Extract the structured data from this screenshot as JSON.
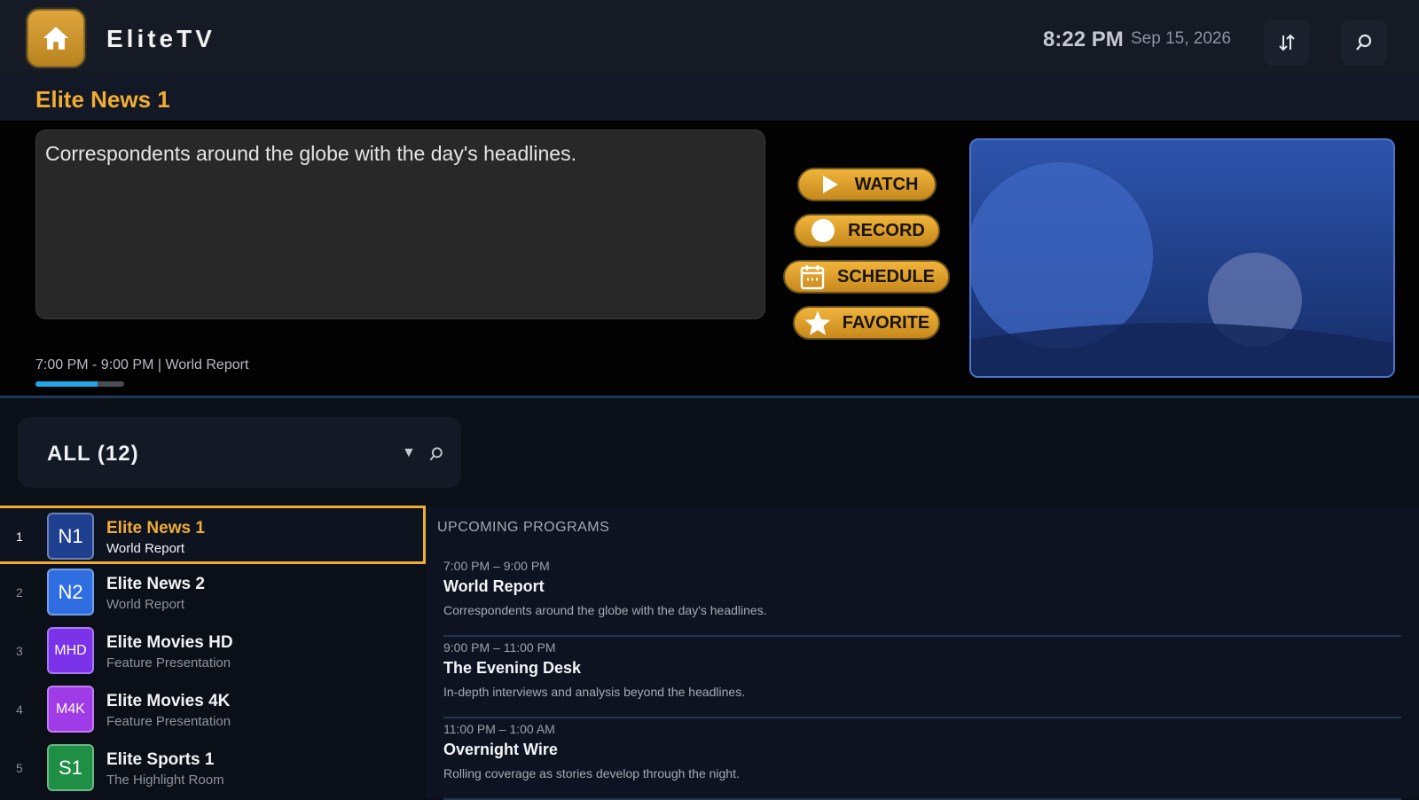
{
  "header": {
    "app_title": "EliteTV",
    "time": "8:22 PM",
    "date": "Sep 15, 2026",
    "icons": [
      "home-icon",
      "sort-icon",
      "search-icon"
    ],
    "accent_color": "#f0ad32"
  },
  "channel": {
    "title": "Elite News 1",
    "description": "Correspondents around the globe with the day's headlines.",
    "time_line": "7:00 PM - 9:00 PM | World Report",
    "progress": 0.7
  },
  "actions": [
    {
      "label": "WATCH",
      "icon": "play-icon"
    },
    {
      "label": "RECORD",
      "icon": "record-icon"
    },
    {
      "label": "SCHEDULE",
      "icon": "calendar-icon"
    },
    {
      "label": "FAVORITE",
      "icon": "star-icon"
    }
  ],
  "filter": {
    "label": "ALL (12)"
  },
  "channels": [
    {
      "number": "1",
      "logo": "N1",
      "logo_color": "#1f3f8f",
      "name": "Elite News 1",
      "program": "World Report"
    },
    {
      "number": "2",
      "logo": "N2",
      "logo_color": "#2f6ee0",
      "name": "Elite News 2",
      "program": "World Report"
    },
    {
      "number": "3",
      "logo": "MHD",
      "logo_color": "#7a33e8",
      "name": "Elite Movies HD",
      "program": "Feature Presentation"
    },
    {
      "number": "4",
      "logo": "M4K",
      "logo_color": "#a03be8",
      "name": "Elite Movies 4K",
      "program": "Feature Presentation"
    },
    {
      "number": "5",
      "logo": "S1",
      "logo_color": "#1f8f46",
      "name": "Elite Sports 1",
      "program": "The Highlight Room"
    }
  ],
  "upcoming": {
    "heading": "UPCOMING PROGRAMS",
    "programs": [
      {
        "time": "7:00 PM – 9:00 PM",
        "title": "World Report",
        "description": "Correspondents around the globe with the day's headlines."
      },
      {
        "time": "9:00 PM – 11:00 PM",
        "title": "The Evening Desk",
        "description": "In-depth interviews and analysis beyond the headlines."
      },
      {
        "time": "11:00 PM – 1:00 AM",
        "title": "Overnight Wire",
        "description": "Rolling coverage as stories develop through the night."
      }
    ]
  }
}
